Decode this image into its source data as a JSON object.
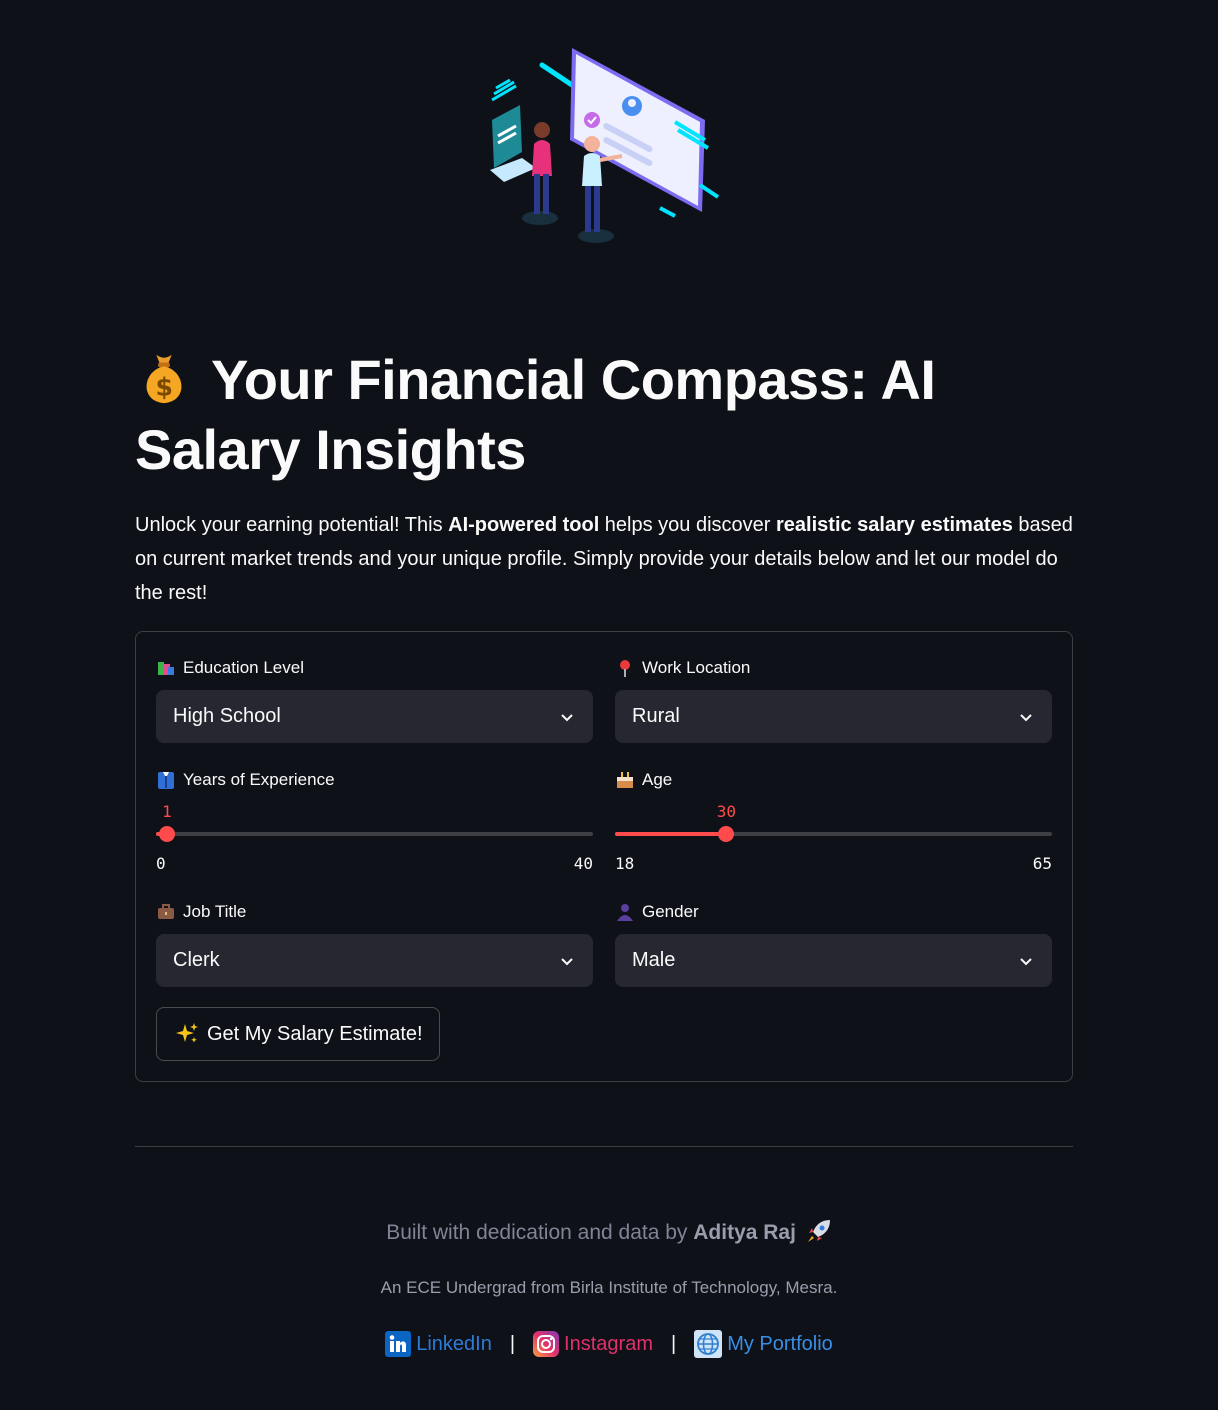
{
  "header": {
    "title": "Your Financial Compass: AI Salary Insights",
    "title_icon": "money-bag-icon"
  },
  "intro": {
    "p1": "Unlock your earning potential! This ",
    "b1": "AI-powered tool",
    "p2": " helps you discover ",
    "b2": "realistic salary estimates",
    "p3": " based on current market trends and your unique profile. Simply provide your details below and let our model do the rest!"
  },
  "form": {
    "education": {
      "label": "Education Level",
      "icon": "books-icon",
      "value": "High School"
    },
    "location": {
      "label": "Work Location",
      "icon": "pin-icon",
      "value": "Rural"
    },
    "experience": {
      "label": "Years of Experience",
      "icon": "suit-icon",
      "value": "1",
      "min": "0",
      "max": "40",
      "fraction": 0.025
    },
    "age": {
      "label": "Age",
      "icon": "cake-icon",
      "value": "30",
      "min": "18",
      "max": "65",
      "fraction": 0.255
    },
    "job": {
      "label": "Job Title",
      "icon": "briefcase-icon",
      "value": "Clerk"
    },
    "gender": {
      "label": "Gender",
      "icon": "person-silhouette-icon",
      "value": "Male"
    },
    "submit_label": "Get My Salary Estimate!",
    "submit_icon": "sparkles-icon"
  },
  "footer": {
    "built_prefix": "Built with dedication and data by ",
    "author": "Aditya Raj",
    "built_icon": "rocket-icon",
    "subtitle": "An ECE Undergrad from Birla Institute of Technology, Mesra.",
    "links": [
      {
        "label": "LinkedIn",
        "icon": "linkedin-icon",
        "color": "#2e7bd6"
      },
      {
        "label": "Instagram",
        "icon": "instagram-icon",
        "color": "#e1306c"
      },
      {
        "label": "My Portfolio",
        "icon": "globe-icon",
        "color": "#3a8ee6"
      }
    ],
    "separator": "|"
  },
  "colors": {
    "background": "#0e1117",
    "accent": "#ff4b4b",
    "input_bg": "#262730"
  }
}
